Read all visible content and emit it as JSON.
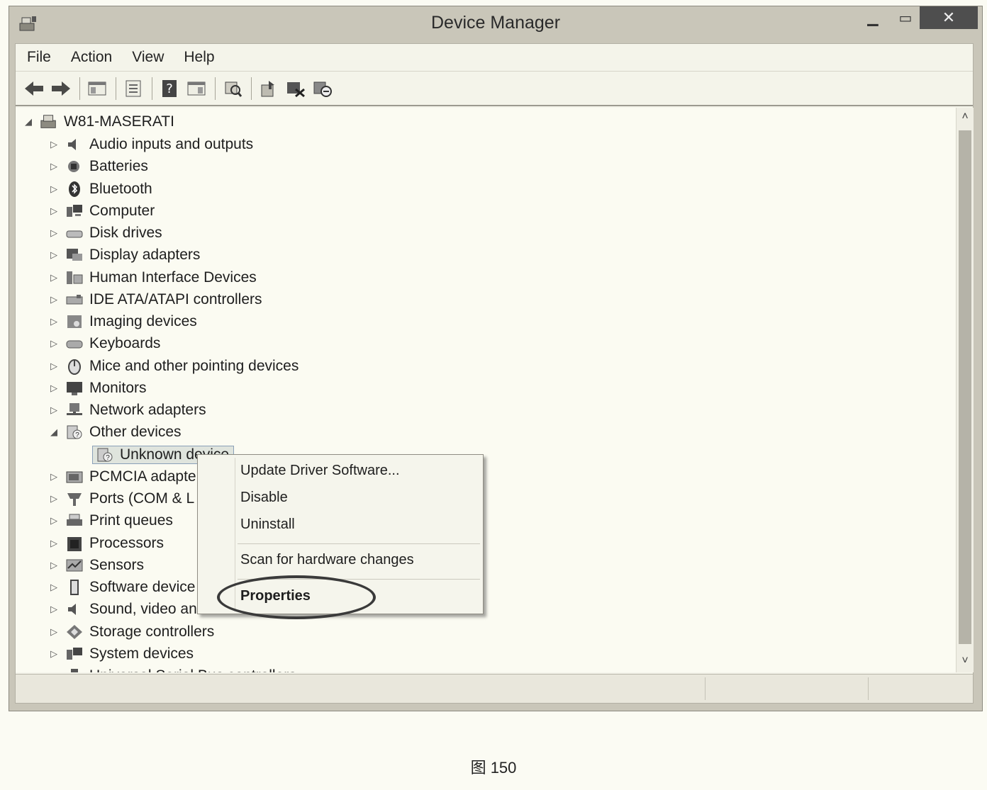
{
  "window": {
    "title": "Device Manager",
    "close_glyph": "✕"
  },
  "menu": [
    "File",
    "Action",
    "View",
    "Help"
  ],
  "toolbar": {
    "icons": [
      "back-icon",
      "forward-icon",
      "show-hide-console-tree-icon",
      "properties-icon",
      "help-icon",
      "action-pane-icon",
      "scan-hardware-icon",
      "update-driver-icon",
      "disable-device-icon",
      "uninstall-device-icon"
    ]
  },
  "tree": {
    "root": "W81-MASERATI",
    "categories": [
      {
        "label": "Audio inputs and outputs",
        "icon": "speaker-icon"
      },
      {
        "label": "Batteries",
        "icon": "battery-icon"
      },
      {
        "label": "Bluetooth",
        "icon": "bluetooth-icon"
      },
      {
        "label": "Computer",
        "icon": "computer-icon"
      },
      {
        "label": "Disk drives",
        "icon": "disk-drive-icon"
      },
      {
        "label": "Display adapters",
        "icon": "display-adapter-icon"
      },
      {
        "label": "Human Interface Devices",
        "icon": "hid-icon"
      },
      {
        "label": "IDE ATA/ATAPI controllers",
        "icon": "ide-controller-icon"
      },
      {
        "label": "Imaging devices",
        "icon": "imaging-icon"
      },
      {
        "label": "Keyboards",
        "icon": "keyboard-icon"
      },
      {
        "label": "Mice and other pointing devices",
        "icon": "mouse-icon"
      },
      {
        "label": "Monitors",
        "icon": "monitor-icon"
      },
      {
        "label": "Network adapters",
        "icon": "network-icon"
      },
      {
        "label": "Other devices",
        "icon": "other-devices-icon",
        "expanded": true
      },
      {
        "label": "Unknown device",
        "icon": "unknown-device-icon",
        "child": true,
        "selected": true
      },
      {
        "label": "PCMCIA adapte",
        "icon": "pcmcia-icon"
      },
      {
        "label": "Ports (COM & L",
        "icon": "ports-icon"
      },
      {
        "label": "Print queues",
        "icon": "printer-icon"
      },
      {
        "label": "Processors",
        "icon": "processor-icon"
      },
      {
        "label": "Sensors",
        "icon": "sensor-icon"
      },
      {
        "label": "Software device",
        "icon": "software-device-icon"
      },
      {
        "label": "Sound, video an",
        "icon": "sound-video-icon"
      },
      {
        "label": "Storage controllers",
        "icon": "storage-icon"
      },
      {
        "label": "System devices",
        "icon": "system-devices-icon"
      },
      {
        "label": "Universal Serial Bus controllers",
        "icon": "usb-icon"
      }
    ]
  },
  "context_menu": {
    "items": [
      "Update Driver Software...",
      "Disable",
      "Uninstall",
      "Scan for hardware changes",
      "Properties"
    ]
  },
  "caption": "图 150"
}
